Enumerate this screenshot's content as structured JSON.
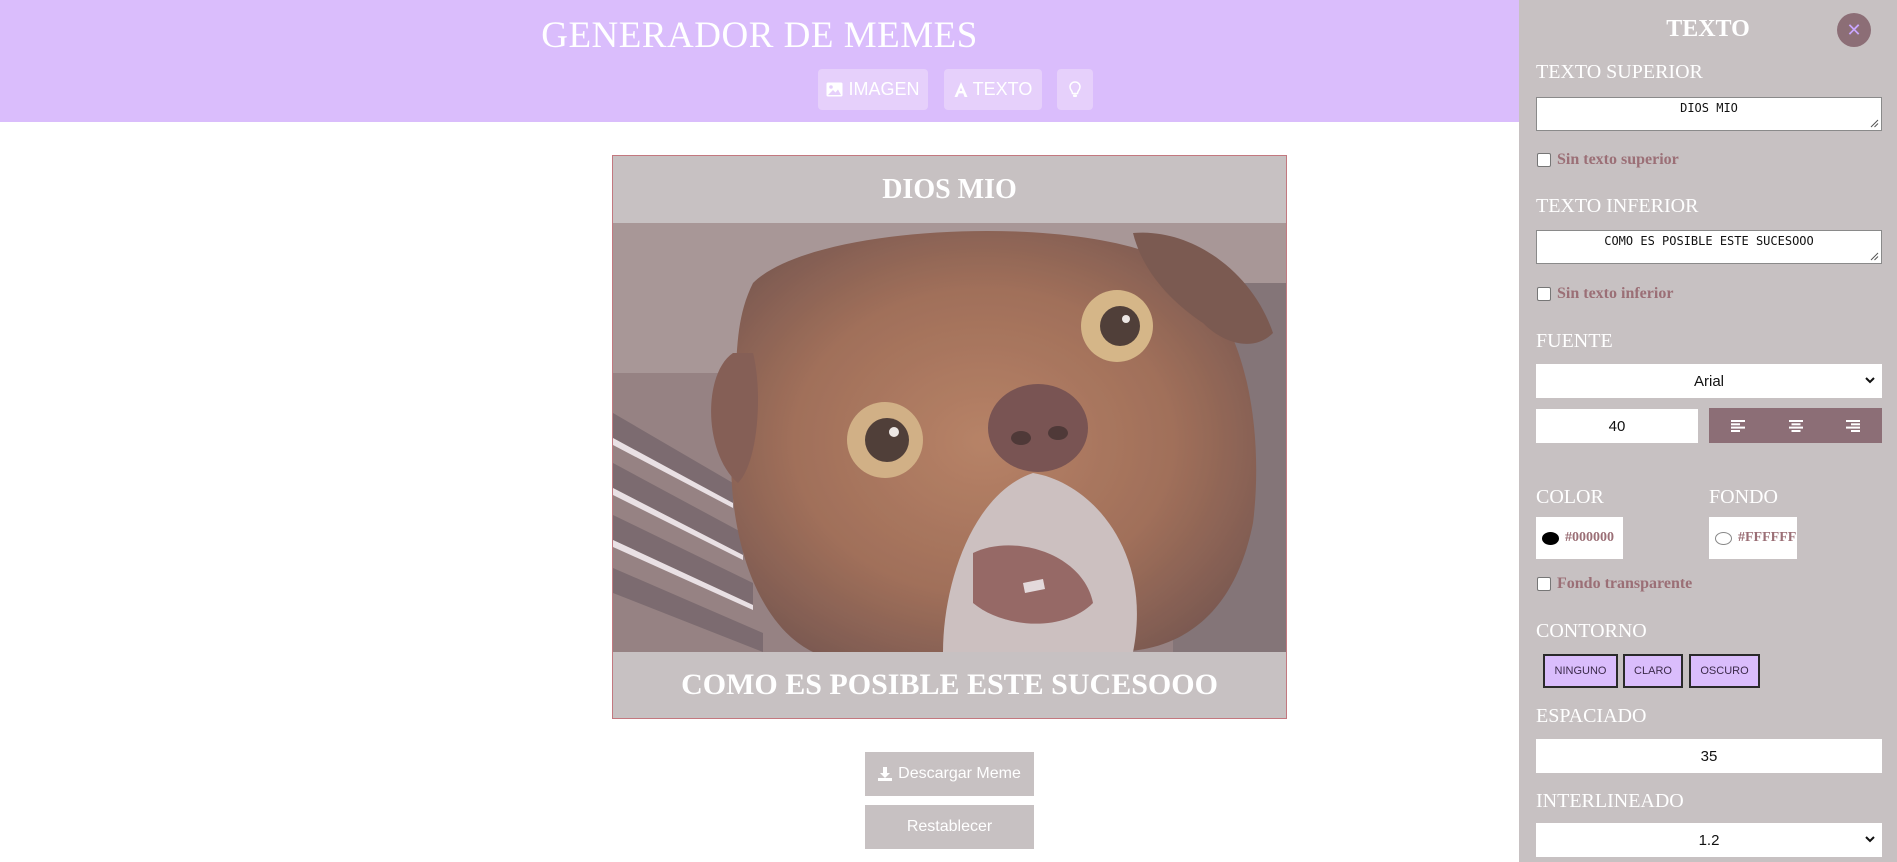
{
  "header": {
    "title": "GENERADOR DE MEMES",
    "tabs": [
      {
        "label": "IMAGEN",
        "icon": "image-icon"
      },
      {
        "label": "TEXTO",
        "icon": "text-icon"
      },
      {
        "label": "",
        "icon": "lightbulb-icon"
      }
    ]
  },
  "meme": {
    "top_text": "DIOS MIO",
    "bottom_text": "COMO ES POSIBLE ESTE SUCESOOO",
    "image": "surprised-dog-photo"
  },
  "actions": {
    "download_label": "Descargar Meme",
    "reset_label": "Restablecer"
  },
  "panel": {
    "title": "TEXTO",
    "close_icon": "close-icon",
    "top_text_label": "TEXTO SUPERIOR",
    "top_text_value": "DIOS MIO",
    "no_top_label": "Sin texto superior",
    "bottom_text_label": "TEXTO INFERIOR",
    "bottom_text_value": "COMO ES POSIBLE ESTE SUCESOOO",
    "no_bottom_label": "Sin texto inferior",
    "font_label": "FUENTE",
    "font_value": "Arial",
    "font_size_value": "40",
    "align_icons": [
      "align-left-icon",
      "align-center-icon",
      "align-right-icon"
    ],
    "color_label": "COLOR",
    "color_value": "#000000",
    "background_label": "FONDO",
    "background_value": "#FFFFFF",
    "transparent_label": "Fondo transparente",
    "outline_label": "CONTORNO",
    "outline_options": [
      "NINGUNO",
      "CLARO",
      "OSCURO"
    ],
    "spacing_label": "ESPACIADO",
    "spacing_value": "35",
    "line_height_label": "INTERLINEADO",
    "line_height_value": "1.2"
  },
  "colors": {
    "header_bg": "#dabdfc",
    "panel_bg": "#c7c1c2",
    "accent": "#8c6e76",
    "checkbox_label": "#9b6f76"
  }
}
